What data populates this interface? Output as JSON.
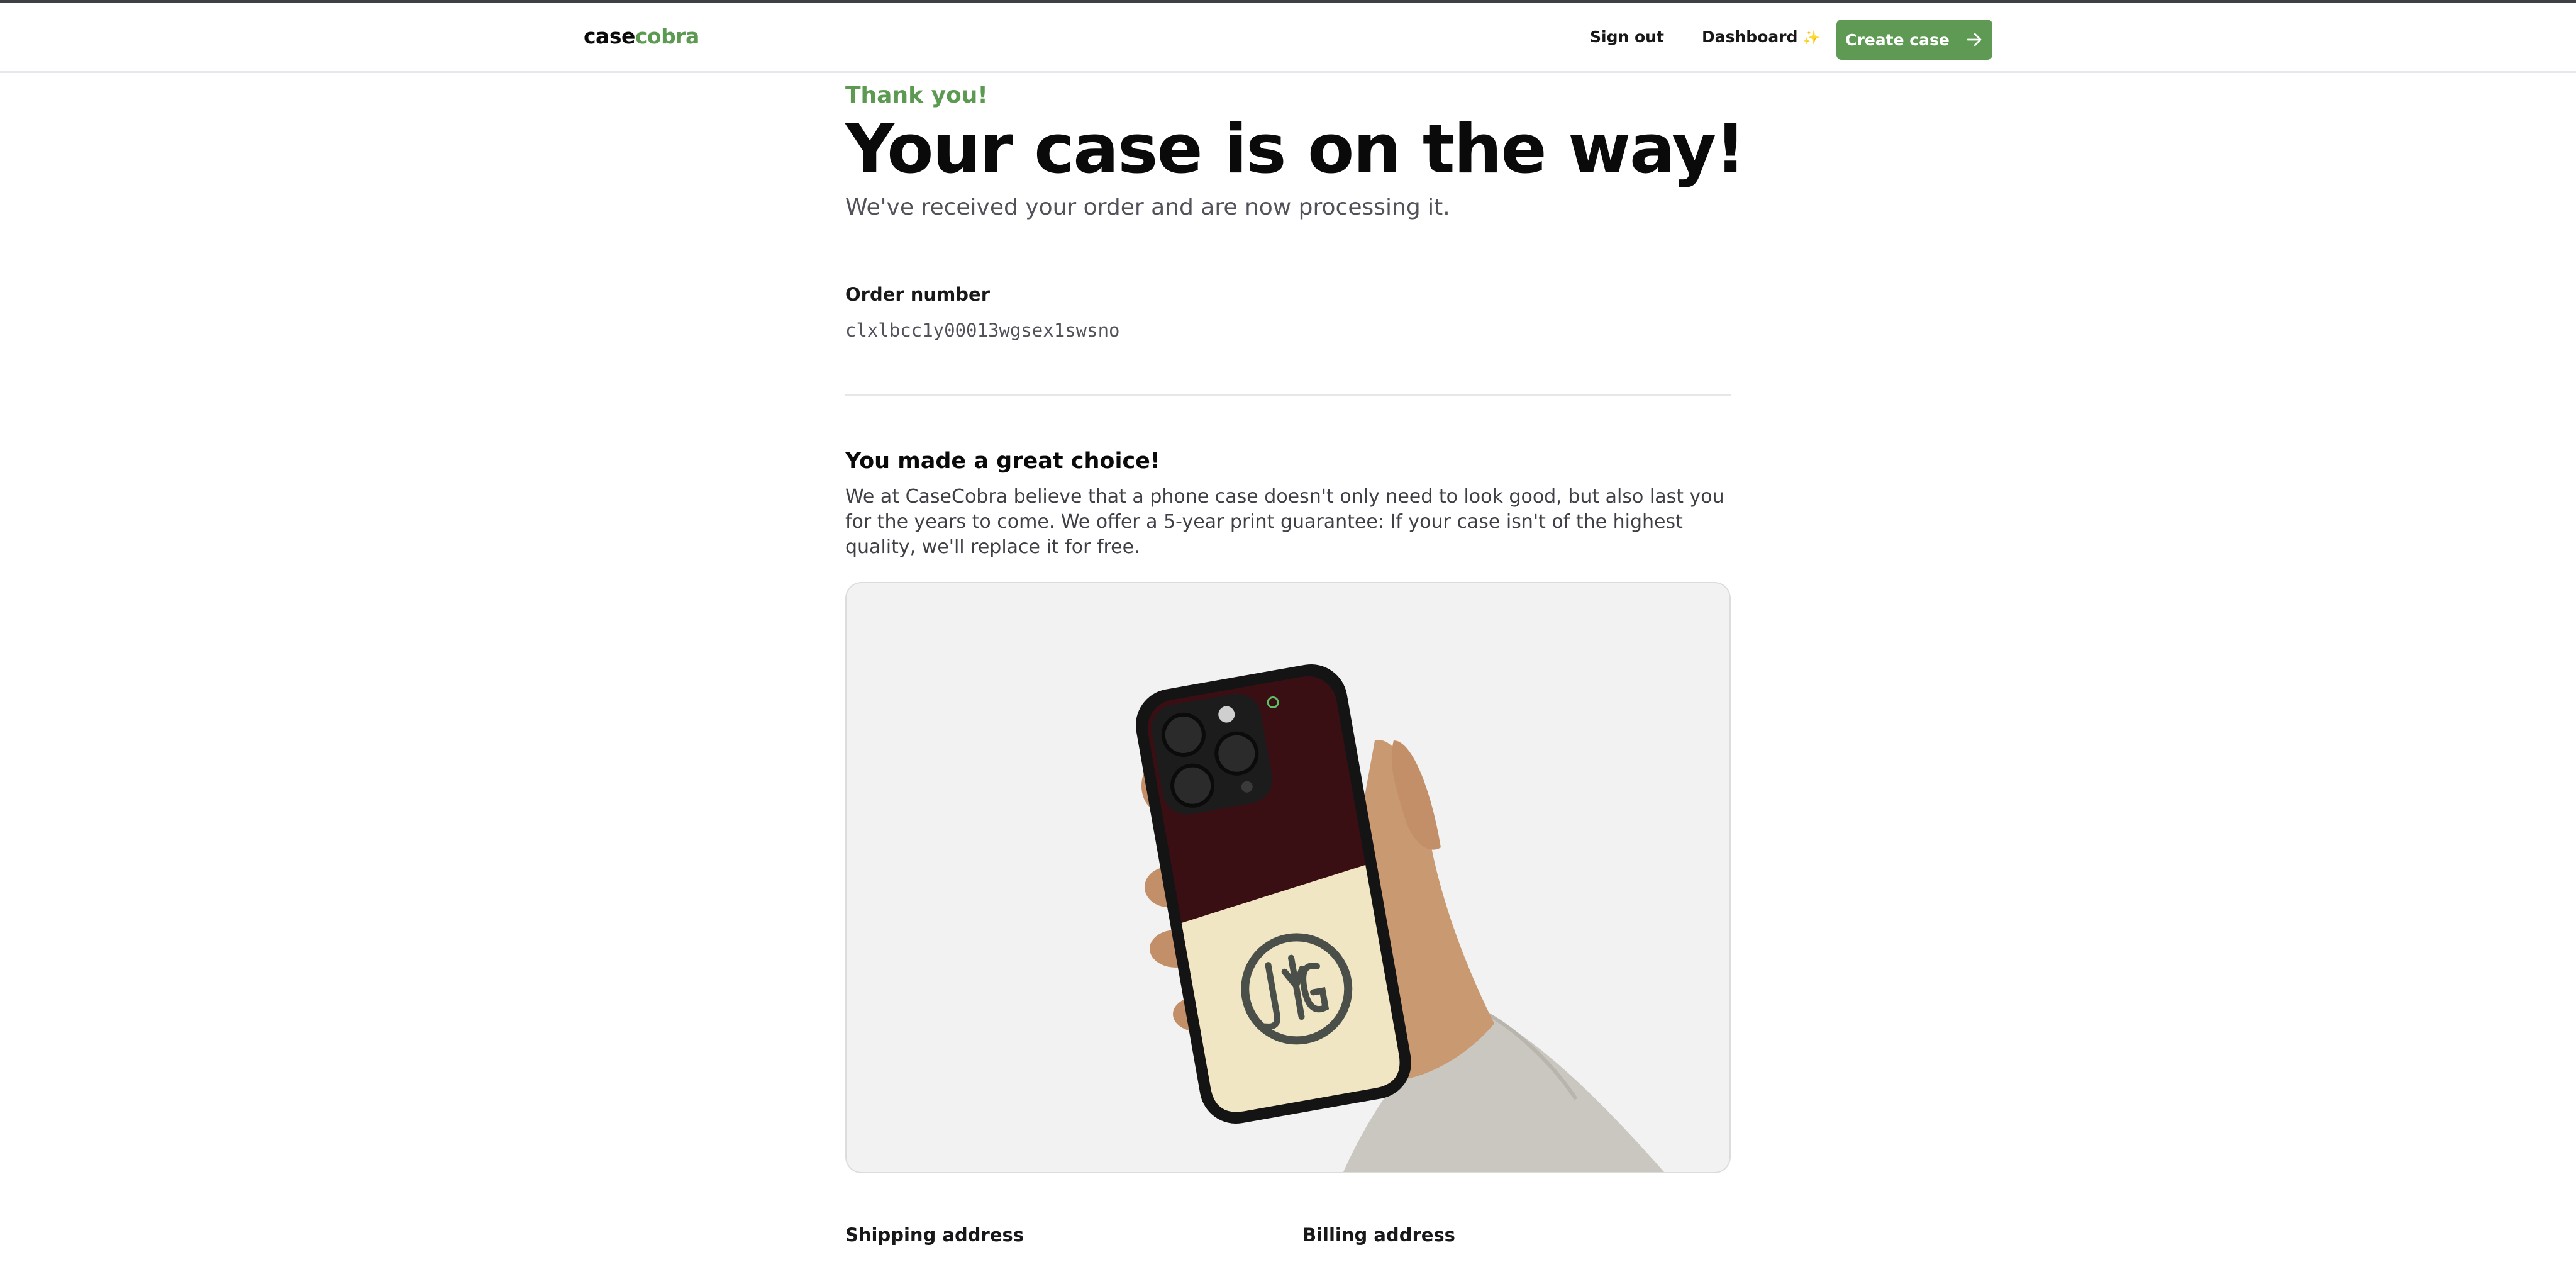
{
  "header": {
    "logo_part1": "case",
    "logo_part2": "cobra",
    "sign_out": "Sign out",
    "dashboard": "Dashboard",
    "dashboard_spark": "✨",
    "create_case": "Create case",
    "accent_color": "#5f9a54"
  },
  "confirmation": {
    "eyebrow": "Thank you!",
    "title": "Your case is on the way!",
    "subtitle": "We've received your order and are now processing it."
  },
  "order": {
    "label": "Order number",
    "value": "clxlbcc1y00013wgsex1swsno"
  },
  "choice": {
    "title": "You made a great choice!",
    "text": "We at CaseCobra believe that a phone case doesn't only need to look good, but also last you for the years to come. We offer a 5-year print guarantee: If your case isn't of the highest quality, we'll replace it for free."
  },
  "image": {
    "icon": "hand-holding-phone-case-preview"
  },
  "addresses": {
    "shipping_label": "Shipping address",
    "billing_label": "Billing address"
  }
}
